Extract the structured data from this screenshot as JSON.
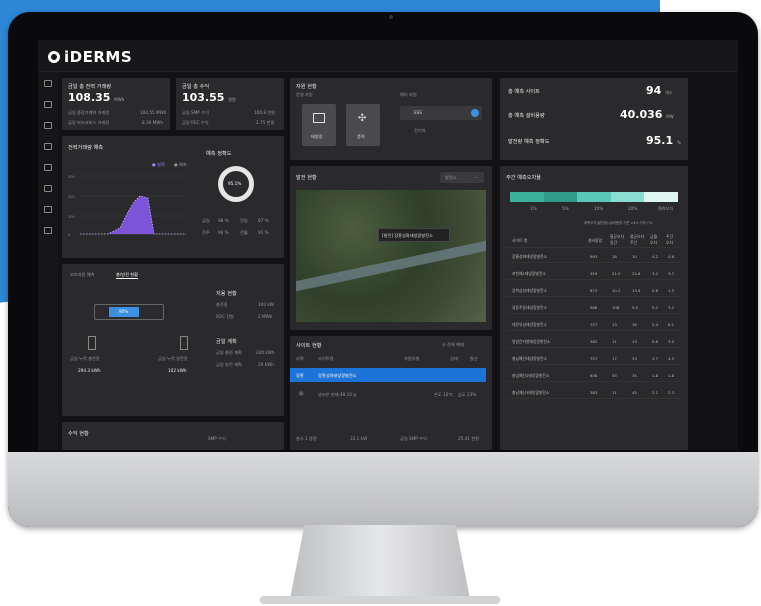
{
  "app": {
    "logo": "iDERMS"
  },
  "kpi": {
    "trade": {
      "title": "금일 총 전력 거래량",
      "value": "108.35",
      "unit": "MWh",
      "rows": [
        [
          "금일 중장기계약 거래량",
          "100.55 MWh"
        ],
        [
          "금일 보조서비스 거래량",
          "8.30 MWh"
        ]
      ]
    },
    "revenue": {
      "title": "금일 총 수익",
      "value": "103.55",
      "unit": "원원",
      "rows": [
        [
          "금일 SMP 수익",
          "100.8 천원"
        ],
        [
          "금일 REC 수익",
          "2.75 천원"
        ]
      ]
    },
    "sites": [
      {
        "label": "총 예측 사이트",
        "value": "94",
        "unit": "개소"
      },
      {
        "label": "총 예측 설비용량",
        "value": "40.036",
        "unit": "MW"
      },
      {
        "label": "발전량 예측 정확도",
        "value": "95.1",
        "unit": "%"
      }
    ]
  },
  "resources": {
    "title": "자원 현황",
    "sub1": "운영 자원",
    "sub2": "예비 자원",
    "btn1": "태양광",
    "btn2": "풍력",
    "ess": "ESS",
    "ev": "전기차"
  },
  "forecast": {
    "title": "전력거래량 예측",
    "legend": [
      "실적",
      "예측"
    ],
    "yticks": [
      "300",
      "200",
      "100",
      "50",
      "0"
    ],
    "accuracy_title": "예측 정확도",
    "gauge": "95.1%",
    "stats": [
      [
        "금일",
        "98 %",
        "전일",
        "97 %"
      ],
      [
        "전주",
        "96 %",
        "전월",
        "91 %"
      ]
    ]
  },
  "plants": {
    "title": "발전 현황",
    "dropdown": "발전소",
    "popup": "[발전] 장흥성화태양광발전소"
  },
  "ranking": {
    "title": "주간 예측오차율",
    "legend": [
      [
        "1%",
        "#3bb39a"
      ],
      [
        "5%",
        "#2f9c88"
      ],
      [
        "10%",
        "#5ac8b8"
      ],
      [
        "20%",
        "#89ddd0"
      ],
      [
        "예측오차",
        "#dff5f2"
      ]
    ],
    "note": "예측오차(발전량)/설비용량 기준 ±4% 이하 (%)",
    "header": [
      "사이트 명",
      "설비용량",
      "평균오차 일간",
      "평균오차 주간",
      "금월 오차",
      "주간 오차"
    ],
    "rows": [
      [
        "장흥성화태양광발전소",
        "993",
        "18",
        "10",
        "4.2",
        "4.6"
      ],
      [
        "포천제1태양광발전소",
        "359",
        "21.0",
        "22.8",
        "3.2",
        "3.7"
      ],
      [
        "경북삼성태양광발전소",
        "873",
        "10.2",
        "13.5",
        "0.8",
        "1.3"
      ],
      [
        "경동주동태양광발전소",
        "968",
        "108",
        "9.0",
        "5.2",
        "3.2"
      ],
      [
        "대전유성태양광발전소",
        "757",
        "13",
        "16",
        "2.4",
        "6.1"
      ],
      [
        "영양잔자봉태양광발전소",
        "382",
        "11",
        "13",
        "0.6",
        "3.0"
      ],
      [
        "충남예산태양광발전소",
        "757",
        "17",
        "33",
        "3.7",
        "4.3"
      ],
      [
        "충남예산2태양광발전소",
        "638",
        "55",
        "35",
        "1.8",
        "1.8"
      ],
      [
        "충남예산3태양광발전소",
        "383",
        "11",
        "45",
        "2.1",
        "2.3"
      ]
    ]
  },
  "switcher": {
    "tab1": "보조자원 예측",
    "tab2": "충/방전 현황",
    "label1": "금일 누적 충전량",
    "label2": "금일 누적 방전량",
    "val1": "294.3 kWh",
    "val2": "102 kWh",
    "badge": "90%",
    "status_title": "저용 현황",
    "status_rows": [
      [
        "충전중",
        "100 kW"
      ],
      [
        "SOC 잔량",
        "2 MWh"
      ]
    ],
    "plan_title": "금일 계획",
    "plan_rows": [
      [
        "금일 충전 계획",
        "240 kWh"
      ],
      [
        "금일 방전 계획",
        "20 kWh"
      ]
    ]
  },
  "sites_list": {
    "title": "사이트 현황",
    "refresh": "전체 해제",
    "header": [
      "지역",
      "사이트명",
      "자원유형",
      "상태",
      "통신"
    ],
    "selected": [
      "장흥",
      "장흥성화태양광발전소"
    ],
    "weather": "날씨온 현재 48.10 g",
    "temp": "온도 10℃",
    "hum": "습도 23%",
    "foot": [
      "총사 1 용량",
      "33.1 kW",
      "금일 SMP 수익",
      "25.41 천원"
    ]
  },
  "bottom": {
    "revenue": "수익 현황",
    "smp": "SMP 수익"
  }
}
